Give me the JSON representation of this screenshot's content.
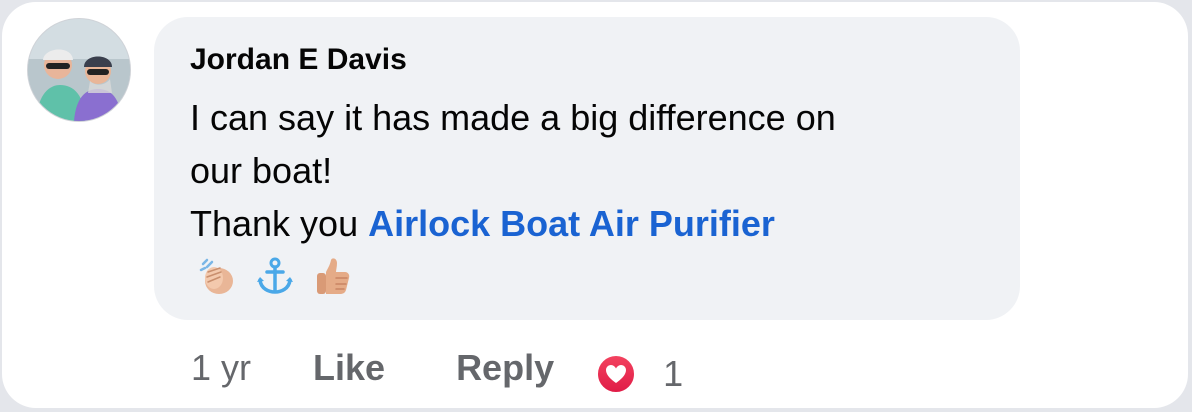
{
  "comment": {
    "author": "Jordan E Davis",
    "lines": [
      "I can say it has made a big difference on",
      "our boat!"
    ],
    "thanks_prefix": "Thank you ",
    "mention": "Airlock Boat Air Purifier",
    "emojis": [
      "clapping-hands",
      "anchor",
      "thumbs-up"
    ]
  },
  "actions": {
    "time": "1 yr",
    "like_label": "Like",
    "reply_label": "Reply",
    "reaction_icon": "love-reaction-icon",
    "reaction_count": "1"
  },
  "colors": {
    "mention": "#1a63d2",
    "bubble": "#f0f2f5",
    "meta_text": "#65676b",
    "heart": "#f0284a"
  }
}
